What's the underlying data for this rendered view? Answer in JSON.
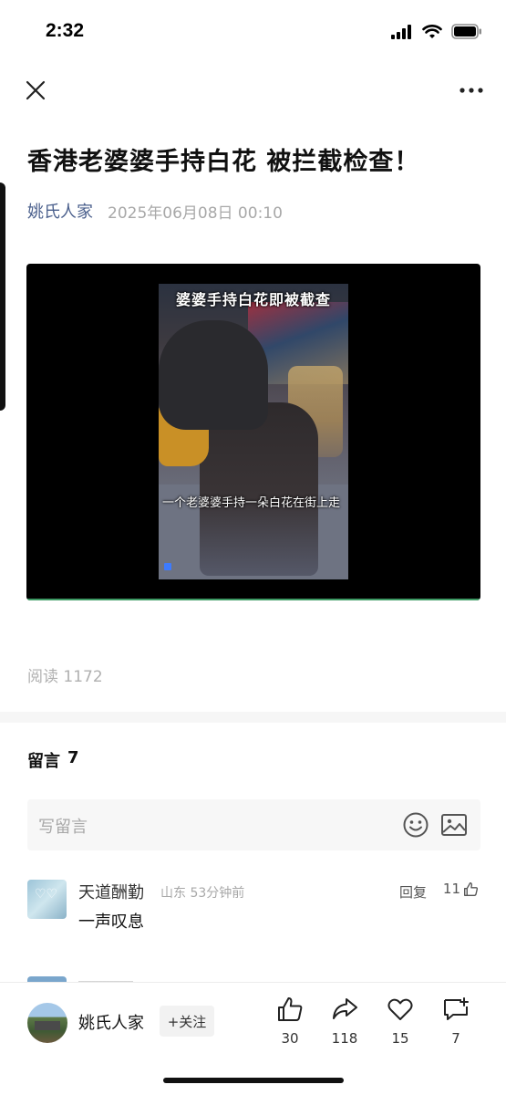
{
  "status_bar": {
    "time": "2:32",
    "icons": [
      "signal-icon",
      "wifi-icon",
      "battery-icon"
    ]
  },
  "nav": {
    "close_icon": "close-icon",
    "more_icon": "more-icon"
  },
  "article": {
    "title": "香港老婆婆手持白花 被拦截检查！",
    "author": "姚氏人家",
    "date": "2025年06月08日 00:10",
    "read_label": "阅读 1172"
  },
  "video": {
    "caption_top": "婆婆手持白花即被截查",
    "caption_bottom": "一个老婆婆手持一朵白花在街上走",
    "progress_color": "#3e9a64"
  },
  "comments": {
    "header_label": "留言",
    "count": "7",
    "placeholder": "写留言",
    "items": [
      {
        "name": "天道酬勤",
        "location_time": "山东 53分钟前",
        "reply_label": "回复",
        "likes": "11",
        "text": "一声叹息"
      }
    ]
  },
  "bottom_bar": {
    "author": "姚氏人家",
    "follow_label": "+关注",
    "actions": [
      {
        "icon": "thumbs-up-icon",
        "count": "30"
      },
      {
        "icon": "share-icon",
        "count": "118"
      },
      {
        "icon": "heart-icon",
        "count": "15"
      },
      {
        "icon": "comment-icon",
        "count": "7"
      }
    ]
  },
  "colors": {
    "author_link": "#4a5f8c",
    "muted": "#a8a8a8",
    "accent_progress": "#3e9a64"
  }
}
